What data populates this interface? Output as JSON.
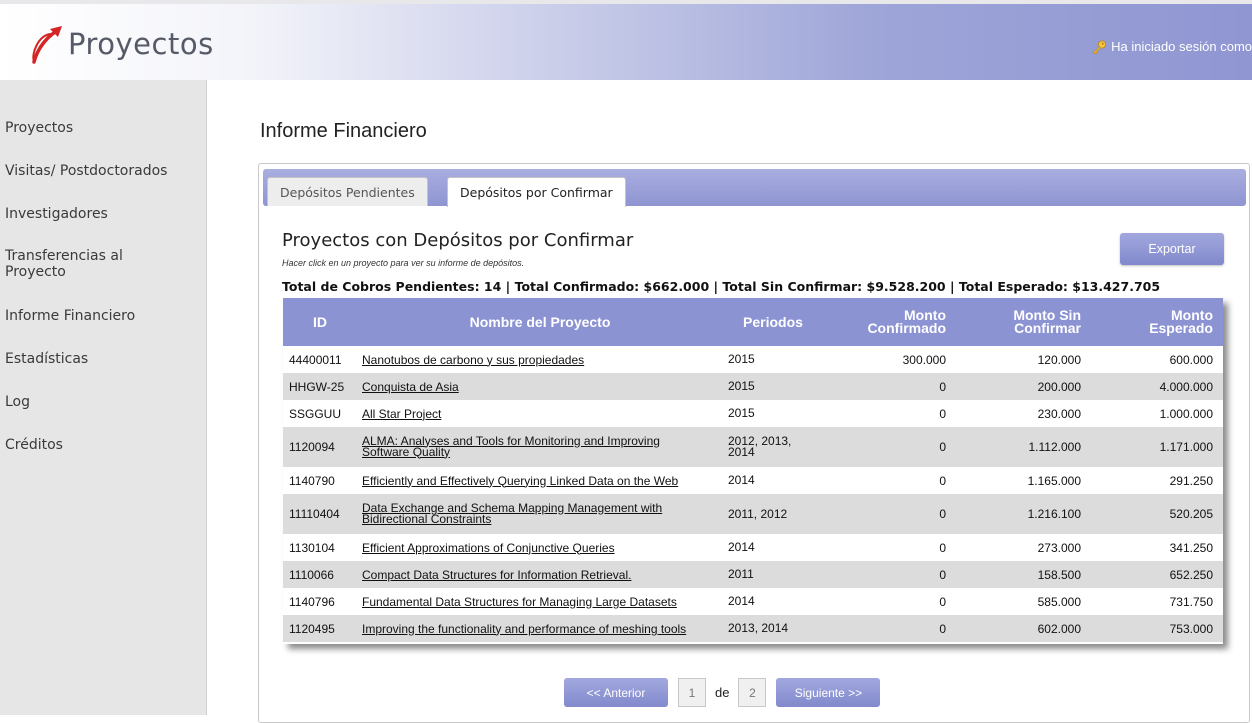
{
  "app": {
    "logo_text": "Proyectos",
    "session_text": "Ha iniciado sesión como"
  },
  "sidebar": {
    "items": [
      {
        "label": "Proyectos"
      },
      {
        "label": "Visitas/ Postdoctorados"
      },
      {
        "label": "Investigadores"
      },
      {
        "label": "Transferencias al Proyecto"
      },
      {
        "label": "Informe Financiero"
      },
      {
        "label": "Estadísticas"
      },
      {
        "label": "Log"
      },
      {
        "label": "Créditos"
      }
    ]
  },
  "page": {
    "title": "Informe Financiero"
  },
  "tabs": [
    {
      "label": "Depósitos Pendientes",
      "active": false
    },
    {
      "label": "Depósitos por Confirmar",
      "active": true
    }
  ],
  "section": {
    "title": "Proyectos con Depósitos por Confirmar",
    "subtitle": "Hacer click en un proyecto para ver su informe de depósitos.",
    "totals": "Total de Cobros Pendientes: 14 | Total Confirmado: $662.000 | Total Sin Confirmar: $9.528.200 | Total Esperado: $13.427.705",
    "export_label": "Exportar"
  },
  "table": {
    "headers": {
      "id": "ID",
      "name": "Nombre del Proyecto",
      "periods": "Periodos",
      "confirmed_1": "Monto",
      "confirmed_2": "Confirmado",
      "unconfirmed_1": "Monto Sin",
      "unconfirmed_2": "Confirmar",
      "expected_1": "Monto",
      "expected_2": "Esperado"
    },
    "rows": [
      {
        "id": "44400011",
        "name_1": "Nanotubos de carbono y sus propiedades",
        "name_2": "",
        "periods_1": "2015",
        "periods_2": "",
        "confirmed": "300.000",
        "unconfirmed": "120.000",
        "expected": "600.000"
      },
      {
        "id": "HHGW-25",
        "name_1": "Conquista de Asia",
        "name_2": "",
        "periods_1": "2015",
        "periods_2": "",
        "confirmed": "0",
        "unconfirmed": "200.000",
        "expected": "4.000.000"
      },
      {
        "id": "SSGGUU",
        "name_1": "All Star Project",
        "name_2": "",
        "periods_1": "2015",
        "periods_2": "",
        "confirmed": "0",
        "unconfirmed": "230.000",
        "expected": "1.000.000"
      },
      {
        "id": "1120094",
        "name_1": "ALMA: Analyses and Tools for Monitoring and Improving",
        "name_2": "Software Quality",
        "periods_1": "2012, 2013,",
        "periods_2": "2014",
        "confirmed": "0",
        "unconfirmed": "1.112.000",
        "expected": "1.171.000"
      },
      {
        "id": "1140790",
        "name_1": "Efficiently and Effectively Querying Linked Data on the Web",
        "name_2": "",
        "periods_1": "2014",
        "periods_2": "",
        "confirmed": "0",
        "unconfirmed": "1.165.000",
        "expected": "291.250"
      },
      {
        "id": "11110404",
        "name_1": "Data Exchange and Schema Mapping Management with",
        "name_2": "Bidirectional Constraints",
        "periods_1": "2011, 2012",
        "periods_2": "",
        "confirmed": "0",
        "unconfirmed": "1.216.100",
        "expected": "520.205"
      },
      {
        "id": "1130104",
        "name_1": "Efficient Approximations of Conjunctive Queries",
        "name_2": "",
        "periods_1": "2014",
        "periods_2": "",
        "confirmed": "0",
        "unconfirmed": "273.000",
        "expected": "341.250"
      },
      {
        "id": "1110066",
        "name_1": "Compact Data Structures for Information Retrieval.",
        "name_2": "",
        "periods_1": "2011",
        "periods_2": "",
        "confirmed": "0",
        "unconfirmed": "158.500",
        "expected": "652.250"
      },
      {
        "id": "1140796",
        "name_1": "Fundamental Data Structures for Managing Large Datasets",
        "name_2": "",
        "periods_1": "2014",
        "periods_2": "",
        "confirmed": "0",
        "unconfirmed": "585.000",
        "expected": "731.750"
      },
      {
        "id": "1120495",
        "name_1": "Improving the functionality and performance of meshing tools",
        "name_2": "",
        "periods_1": "2013, 2014",
        "periods_2": "",
        "confirmed": "0",
        "unconfirmed": "602.000",
        "expected": "753.000"
      }
    ]
  },
  "pagination": {
    "prev_label": "<< Anterior",
    "current_page": "1",
    "of_label": "de",
    "total_pages": "2",
    "next_label": "Siguiente >>"
  },
  "colors": {
    "accent": "#8c93d3",
    "sidebar_bg": "#e6e6e6",
    "row_alt": "#dcdcdc",
    "logo_red": "#d42525"
  },
  "icons": {
    "logo": "logo-arrow-icon",
    "session": "key-icon"
  }
}
